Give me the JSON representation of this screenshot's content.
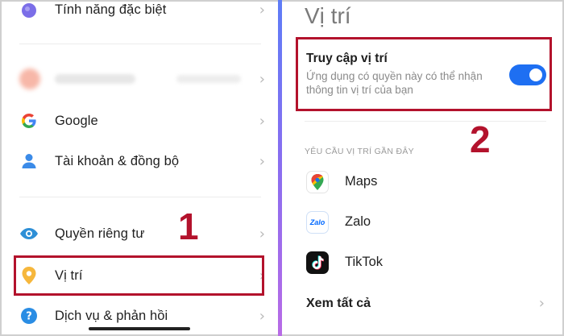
{
  "left_panel": {
    "items": [
      {
        "label": "Tính năng đặc biệt",
        "icon": "purple-drop-icon"
      },
      {
        "label": "",
        "icon": "blurred-icon"
      },
      {
        "label": "Google",
        "icon": "google-g-icon"
      },
      {
        "label": "Tài khoản & đồng bộ",
        "icon": "person-icon"
      },
      {
        "label": "Quyền riêng tư",
        "icon": "eye-icon"
      },
      {
        "label": "Vị trí",
        "icon": "location-pin-icon"
      },
      {
        "label": "Dịch vụ & phản hồi",
        "icon": "help-icon"
      }
    ]
  },
  "right_panel": {
    "title": "Vị trí",
    "location_access": {
      "title": "Truy cập vị trí",
      "description": "Ứng dụng có quyền này có thể nhận thông tin vị trí của bạn",
      "enabled": true
    },
    "recent_requests_header": "YÊU CẦU VỊ TRÍ GẦN ĐÂY",
    "apps": [
      {
        "label": "Maps",
        "icon": "google-maps-icon"
      },
      {
        "label": "Zalo",
        "icon": "zalo-icon",
        "icon_text": "Zalo"
      },
      {
        "label": "TikTok",
        "icon": "tiktok-icon"
      }
    ],
    "see_all": "Xem tất cả"
  },
  "annotations": {
    "step1": "1",
    "step2": "2"
  },
  "colors": {
    "accent_blue": "#1e6ff2",
    "highlight_red": "#b3122c"
  }
}
